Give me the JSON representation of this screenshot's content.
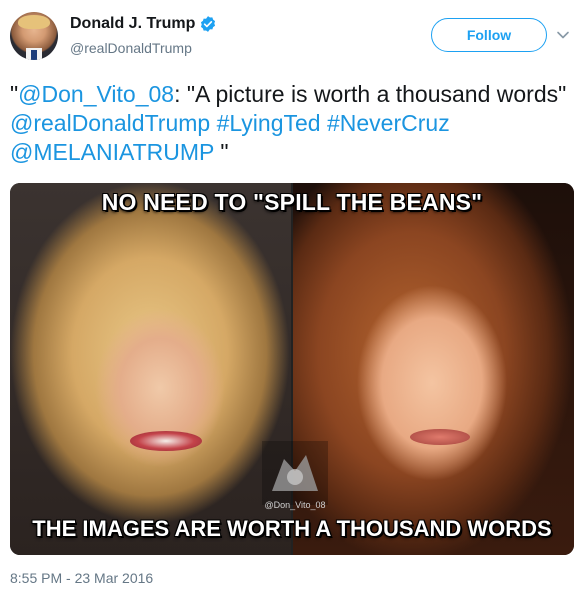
{
  "user": {
    "display_name": "Donald J. Trump",
    "handle": "@realDonaldTrump",
    "verified_icon": "verified-badge-icon",
    "avatar_icon": "profile-avatar"
  },
  "actions": {
    "follow_label": "Follow",
    "more_icon": "chevron-down-icon"
  },
  "tweet": {
    "quote_open": "\"",
    "mention_1": "@Don_Vito_08",
    "text_1": ": \"A picture is worth a thousand words\" ",
    "mention_2": "@realDonaldTrump",
    "hashtag_1": "#LyingTed",
    "hashtag_2": "#NeverCruz",
    "mention_3": "@MELANIATRUMP",
    "quote_close": " \""
  },
  "media": {
    "top_caption": "NO NEED TO \"SPILL THE BEANS\"",
    "bottom_caption": "THE IMAGES ARE WORTH A THOUSAND WORDS",
    "watermark": "@Don_Vito_08"
  },
  "timestamp": "8:55 PM - 23 Mar 2016",
  "colors": {
    "link": "#1b95e0",
    "follow_border": "#1da1f2",
    "muted": "#657786"
  }
}
